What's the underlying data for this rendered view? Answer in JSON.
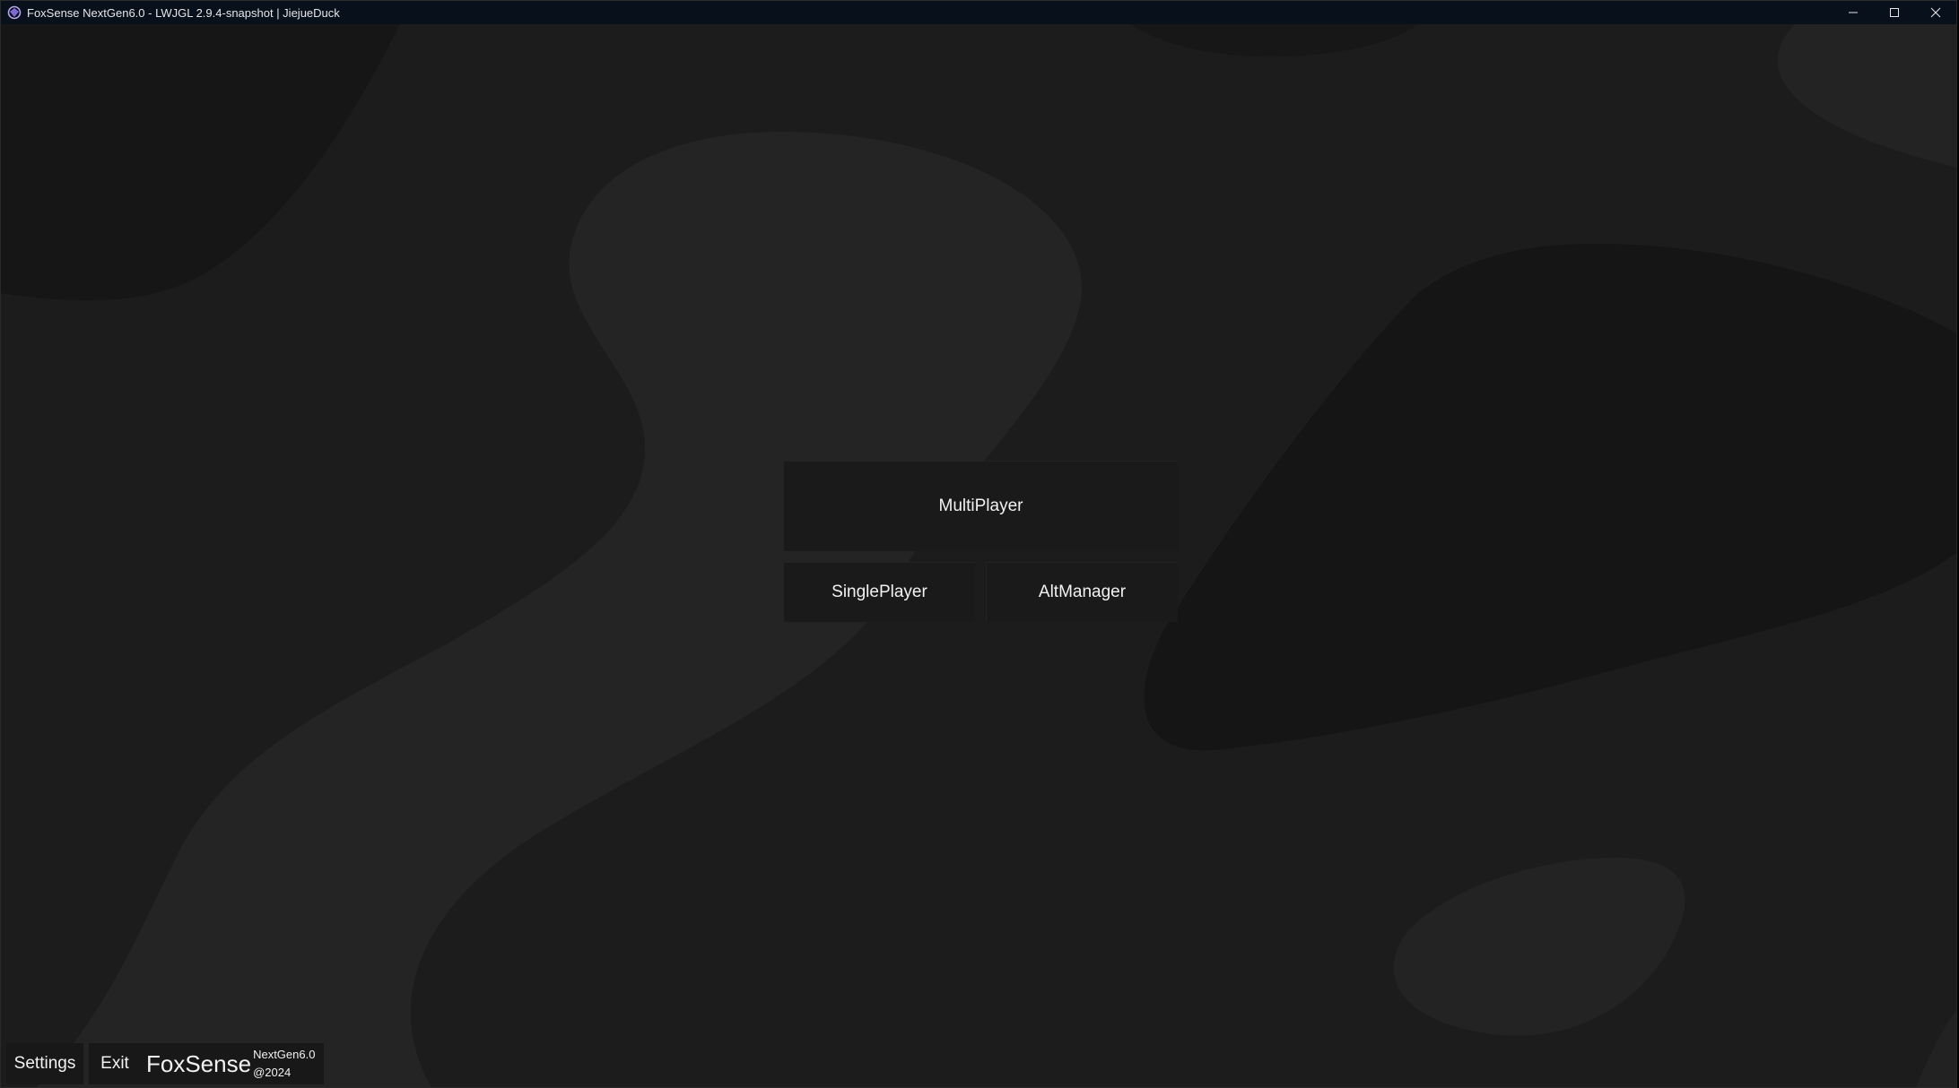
{
  "window": {
    "title": "FoxSense NextGen6.0 - LWJGL 2.9.4-snapshot | JiejueDuck",
    "controls": {
      "minimize": "minimize-icon",
      "maximize": "maximize-icon",
      "close": "close-icon"
    }
  },
  "menu": {
    "multiplayer_label": "MultiPlayer",
    "singleplayer_label": "SinglePlayer",
    "altmanager_label": "AltManager"
  },
  "bottom_bar": {
    "settings_label": "Settings",
    "exit_label": "Exit",
    "brand_name": "FoxSense",
    "brand_version": "NextGen6.0",
    "brand_year": "@2024"
  },
  "colors": {
    "background": "#1c1c1c",
    "blob_light": "#242424",
    "blob_dark": "#151515",
    "button_bg": "#1a1a1a",
    "titlebar_bg": "#08101c",
    "text": "#f2f2f2"
  }
}
